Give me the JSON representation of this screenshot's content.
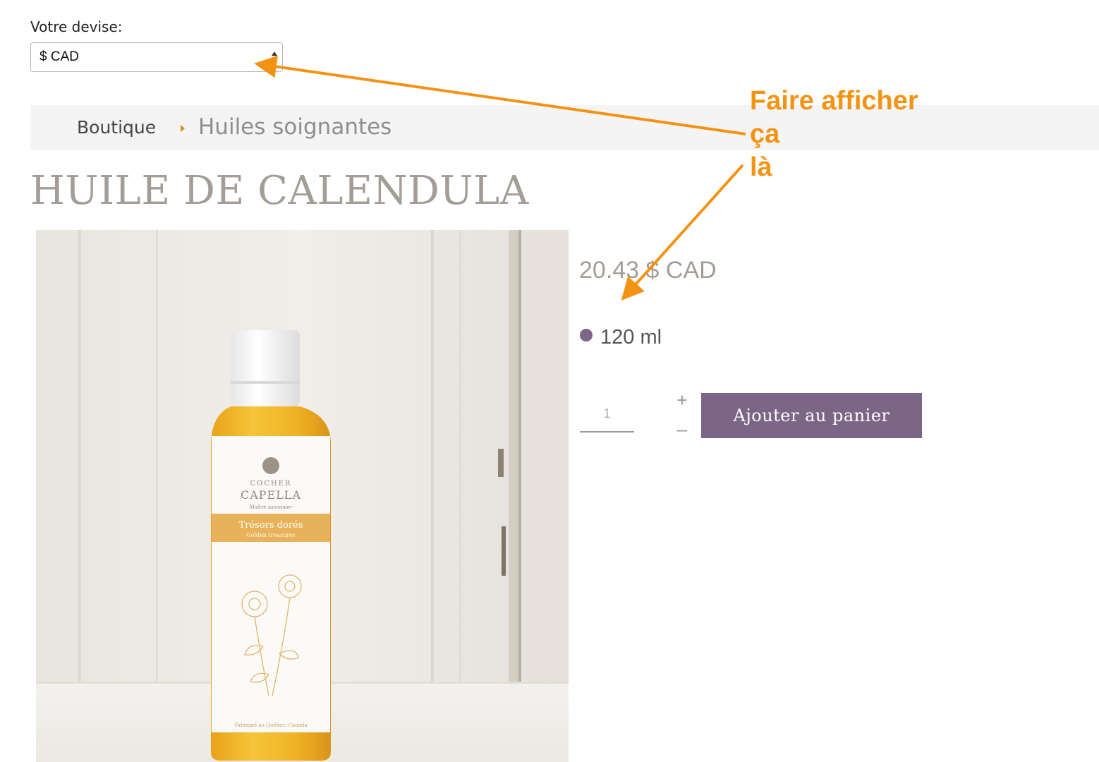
{
  "currency": {
    "label": "Votre devise:",
    "selected": "$ CAD"
  },
  "breadcrumb": {
    "home": "Boutique",
    "separator": "›",
    "current": "Huiles soignantes"
  },
  "product": {
    "title": "HUILE DE CALENDULA",
    "price": "20.43 $ CAD",
    "variant": "120 ml",
    "quantity": "1",
    "add_to_cart": "Ajouter au panier",
    "image": {
      "brand_line1": "COCHER",
      "brand_line2": "CAPELLA",
      "brand_tagline": "Maître savonnier",
      "collection": "Trésors dorés",
      "collection_en": "Golden treasures",
      "origin": "Fabriqué au Québec, Canada"
    }
  },
  "annotation": {
    "line1": "Faire afficher",
    "line2": "ça",
    "line3": "là",
    "color": "#f39314"
  },
  "colors": {
    "accent": "#7c6687",
    "title": "#a39d96",
    "annotation": "#f39314"
  }
}
